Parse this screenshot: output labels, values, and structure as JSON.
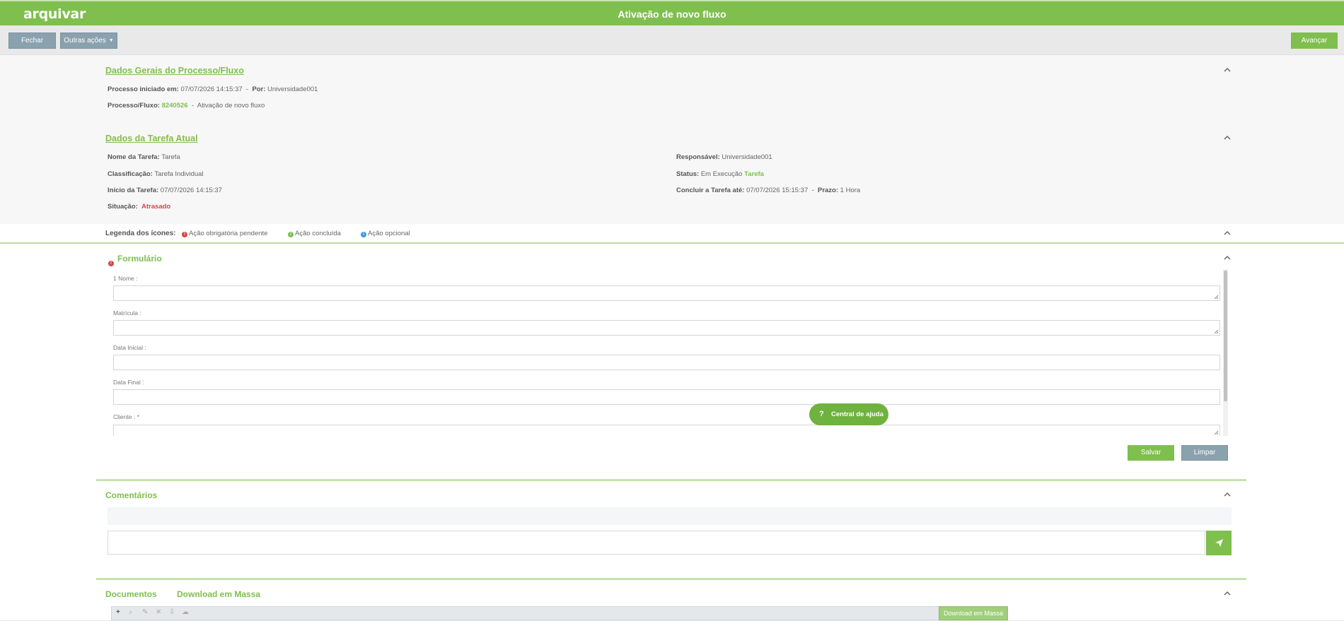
{
  "header": {
    "logo": "arquivar",
    "title": "Ativação de novo fluxo"
  },
  "toolbar": {
    "close_label": "Fechar",
    "more_actions_label": "Outras ações",
    "advance_label": "Avançar"
  },
  "process_section": {
    "title": "Dados Gerais do Processo/Fluxo",
    "started_label": "Processo iniciado em:",
    "started_value": "07/07/2026 14:15:37",
    "by_label": "Por:",
    "by_value": "Universidade001",
    "flow_label": "Processo/Fluxo:",
    "flow_id": "8240526",
    "flow_name": "Ativação de novo fluxo"
  },
  "task_section": {
    "title": "Dados da Tarefa Atual",
    "name_label": "Nome da Tarefa:",
    "name_value": "Tarefa",
    "classification_label": "Classificação:",
    "classification_value": "Tarefa Individual",
    "start_label": "Início da Tarefa:",
    "start_value": "07/07/2026 14:15:37",
    "situation_label": "Situação:",
    "situation_value": "Atrasado",
    "responsible_label": "Responsável:",
    "responsible_value": "Universidade001",
    "status_label": "Status:",
    "status_value": "Em Execução",
    "status_tag": "Tarefa",
    "due_label": "Concluir a Tarefa até:",
    "due_value": "07/07/2026 15:15:37",
    "deadline_label": "Prazo:",
    "deadline_value": "1 Hora"
  },
  "legend": {
    "title": "Legenda dos ícones:",
    "items": [
      {
        "label": "Ação obrigatória pendente",
        "color": "#d64545",
        "icon": "exclamation-icon"
      },
      {
        "label": "Ação concluída",
        "color": "#7fbf4d",
        "icon": "exclamation-icon"
      },
      {
        "label": "Ação opcional",
        "color": "#3a9ad9",
        "icon": "info-icon"
      }
    ]
  },
  "form": {
    "title": "Formulário",
    "fields": [
      {
        "label": "1 Nome :",
        "value": ""
      },
      {
        "label": "Matrícula :",
        "value": ""
      },
      {
        "label": "Data Inicial :",
        "value": ""
      },
      {
        "label": "Data Final :",
        "value": ""
      },
      {
        "label": "Cliente : *",
        "value": ""
      }
    ],
    "save_label": "Salvar",
    "clear_label": "Limpar"
  },
  "help": {
    "icon": "?",
    "label": "Central de ajuda"
  },
  "comments": {
    "title": "Comentários",
    "input_value": ""
  },
  "documents": {
    "title": "Documentos",
    "download_title": "Download em Massa",
    "download_button": "Download em Massa",
    "tools": [
      "+",
      "⌕",
      "✎",
      "✕",
      "⇩",
      "☁"
    ]
  },
  "colors": {
    "brand_green": "#7fbf4d",
    "button_gray": "#8aa1ae",
    "alert_red": "#d64545",
    "info_blue": "#3a9ad9"
  }
}
